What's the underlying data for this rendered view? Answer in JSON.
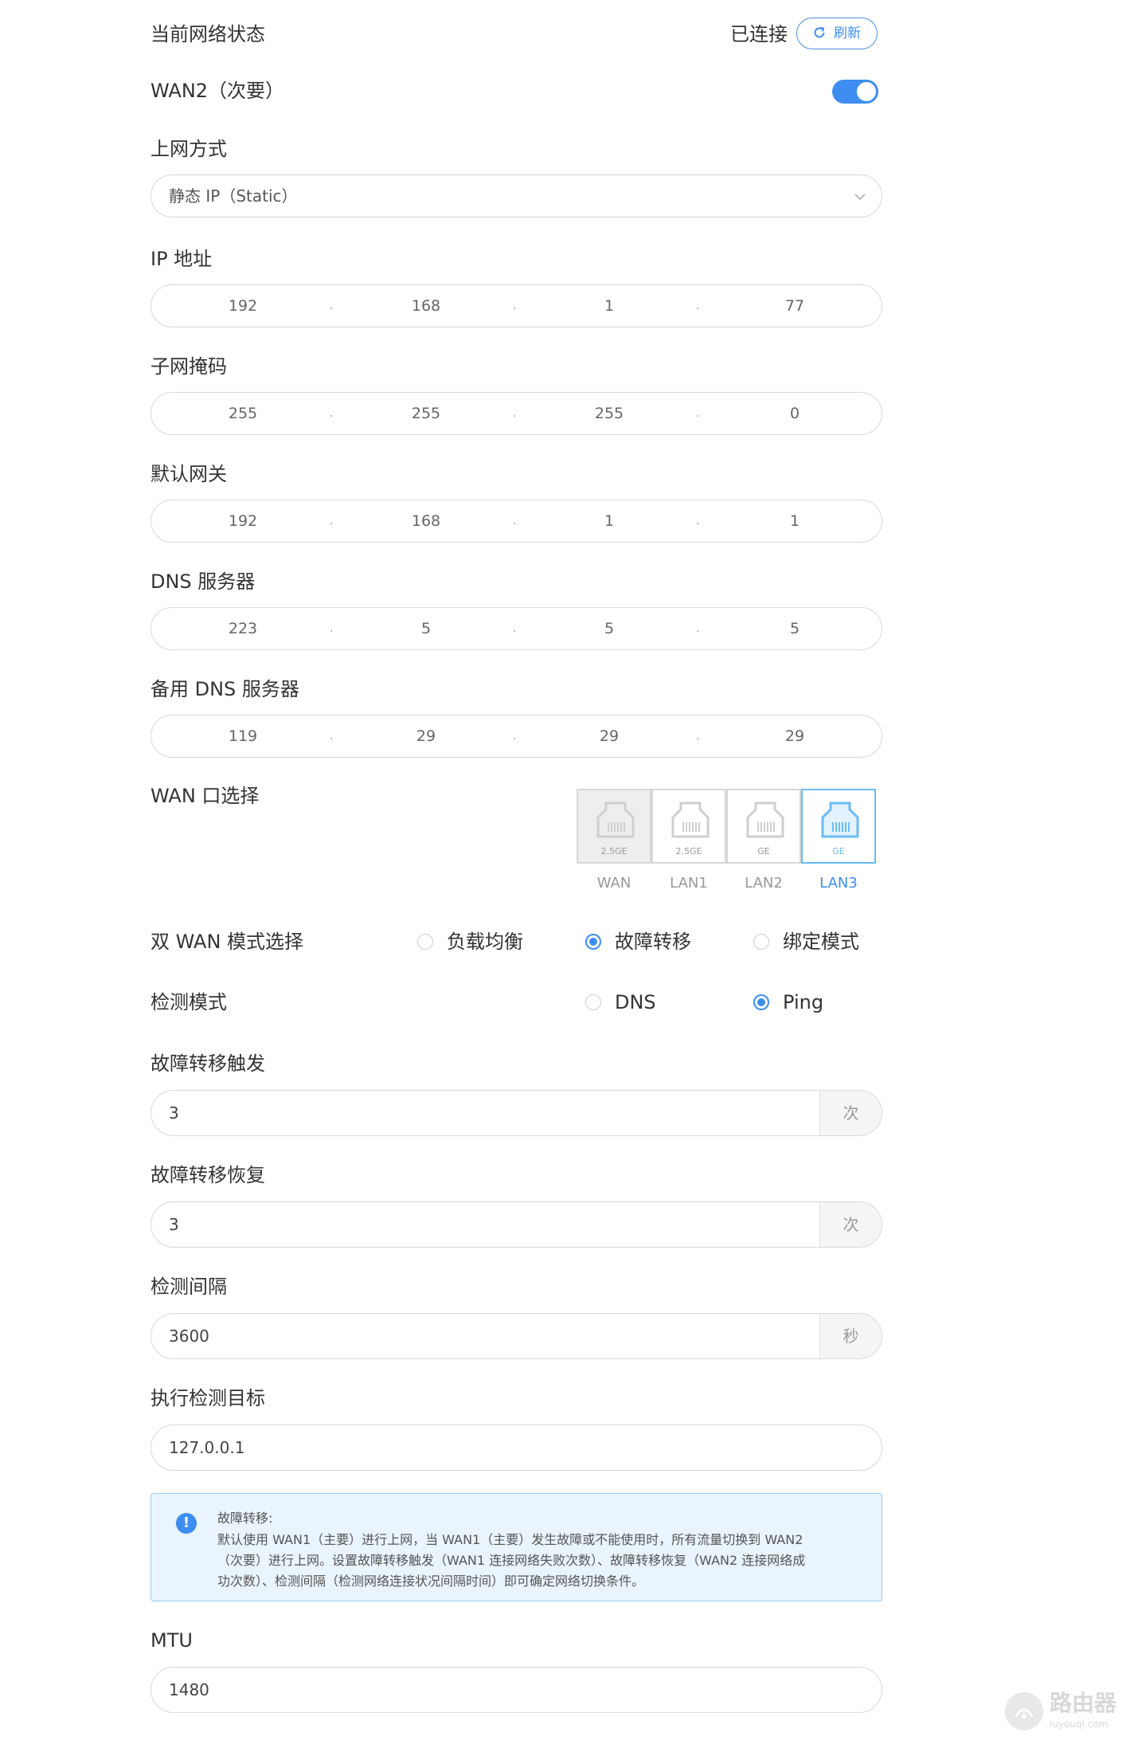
{
  "status": {
    "label": "当前网络状态",
    "value": "已连接",
    "refresh_label": "刷新"
  },
  "wan2": {
    "label": "WAN2（次要）",
    "enabled": true
  },
  "conn_type": {
    "label": "上网方式",
    "value": "静态 IP（Static）"
  },
  "ip": {
    "label": "IP 地址",
    "octets": [
      "192",
      "168",
      "1",
      "77"
    ]
  },
  "mask": {
    "label": "子网掩码",
    "octets": [
      "255",
      "255",
      "255",
      "0"
    ]
  },
  "gateway": {
    "label": "默认网关",
    "octets": [
      "192",
      "168",
      "1",
      "1"
    ]
  },
  "dns": {
    "label": "DNS 服务器",
    "octets": [
      "223",
      "5",
      "5",
      "5"
    ]
  },
  "dns2": {
    "label": "备用 DNS 服务器",
    "octets": [
      "119",
      "29",
      "29",
      "29"
    ]
  },
  "ip_separator": ".",
  "wan_port": {
    "label": "WAN 口选择",
    "ports": [
      {
        "name": "WAN",
        "speed": "2.5GE",
        "selected": false
      },
      {
        "name": "LAN1",
        "speed": "2.5GE",
        "selected": false
      },
      {
        "name": "LAN2",
        "speed": "GE",
        "selected": false
      },
      {
        "name": "LAN3",
        "speed": "GE",
        "selected": true
      }
    ]
  },
  "dual_wan_mode": {
    "label": "双 WAN 模式选择",
    "options": [
      "负载均衡",
      "故障转移",
      "绑定模式"
    ],
    "selected": "故障转移"
  },
  "detect_mode": {
    "label": "检测模式",
    "options": [
      "DNS",
      "Ping"
    ],
    "selected": "Ping"
  },
  "failover_trigger": {
    "label": "故障转移触发",
    "value": "3",
    "unit": "次"
  },
  "failover_restore": {
    "label": "故障转移恢复",
    "value": "3",
    "unit": "次"
  },
  "detect_interval": {
    "label": "检测间隔",
    "value": "3600",
    "unit": "秒"
  },
  "detect_target": {
    "label": "执行检测目标",
    "value": "127.0.0.1"
  },
  "info": {
    "title": "故障转移:",
    "line1": "默认使用 WAN1（主要）进行上网，当 WAN1（主要）发生故障或不能使用时，所有流量切换到 WAN2",
    "line2": "（次要）进行上网。设置故障转移触发（WAN1 连接网络失败次数）、故障转移恢复（WAN2 连接网络成",
    "line3": "功次数）、检测间隔（检测网络连接状况间隔时间）即可确定网络切换条件。"
  },
  "mtu": {
    "label": "MTU",
    "value": "1480"
  },
  "watermark": {
    "text": "路由器",
    "subtext": "luyouqi.com"
  },
  "colors": {
    "accent": "#3d8ef0",
    "port_selected": "#6bbcf3",
    "info_bg": "#e9f4fc",
    "info_border": "#9ccdf2"
  }
}
